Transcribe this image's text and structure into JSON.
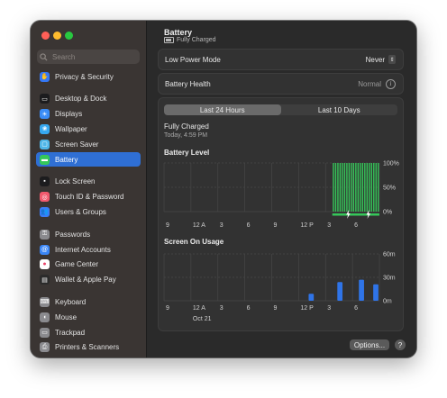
{
  "window": {
    "search_placeholder": "Search",
    "sidebar": {
      "groups": [
        [
          {
            "label": "Privacy & Security",
            "icon": "hand-icon",
            "color": "#3478f6",
            "glyph": "✋"
          }
        ],
        [
          {
            "label": "Desktop & Dock",
            "icon": "desktop-icon",
            "color": "#1c1c1e",
            "glyph": "▭"
          },
          {
            "label": "Displays",
            "icon": "displays-icon",
            "color": "#3a8cf7",
            "glyph": "☀"
          },
          {
            "label": "Wallpaper",
            "icon": "wallpaper-icon",
            "color": "#36a8f0",
            "glyph": "❀"
          },
          {
            "label": "Screen Saver",
            "icon": "screen-saver-icon",
            "color": "#4fb6e8",
            "glyph": "▢"
          },
          {
            "label": "Battery",
            "icon": "battery-icon",
            "color": "#35c759",
            "glyph": "▬"
          }
        ],
        [
          {
            "label": "Lock Screen",
            "icon": "lock-screen-icon",
            "color": "#1c1c1e",
            "glyph": "▪"
          },
          {
            "label": "Touch ID & Password",
            "icon": "fingerprint-icon",
            "color": "#f25a6e",
            "glyph": "◎"
          },
          {
            "label": "Users & Groups",
            "icon": "users-icon",
            "color": "#3a7cf6",
            "glyph": "👥"
          }
        ],
        [
          {
            "label": "Passwords",
            "icon": "key-icon",
            "color": "#8a8a8e",
            "glyph": "⚿"
          },
          {
            "label": "Internet Accounts",
            "icon": "at-icon",
            "color": "#3a86f6",
            "glyph": "@"
          },
          {
            "label": "Game Center",
            "icon": "game-center-icon",
            "color": "#ffffff",
            "glyph": "●"
          },
          {
            "label": "Wallet & Apple Pay",
            "icon": "wallet-icon",
            "color": "#2b2b2b",
            "glyph": "▤"
          }
        ],
        [
          {
            "label": "Keyboard",
            "icon": "keyboard-icon",
            "color": "#8a8a8e",
            "glyph": "⌨"
          },
          {
            "label": "Mouse",
            "icon": "mouse-icon",
            "color": "#8a8a8e",
            "glyph": "◖"
          },
          {
            "label": "Trackpad",
            "icon": "trackpad-icon",
            "color": "#8a8a8e",
            "glyph": "▭"
          },
          {
            "label": "Printers & Scanners",
            "icon": "printer-icon",
            "color": "#8a8a8e",
            "glyph": "⎙"
          }
        ]
      ],
      "selected": "Battery"
    }
  },
  "header": {
    "title": "Battery",
    "status": "Fully Charged"
  },
  "settings": {
    "low_power_label": "Low Power Mode",
    "low_power_value": "Never",
    "health_label": "Battery Health",
    "health_value": "Normal"
  },
  "history": {
    "tabs": [
      "Last 24 Hours",
      "Last 10 Days"
    ],
    "active_tab": 0,
    "charge_state": "Fully Charged",
    "charge_time": "Today, 4:59 PM",
    "battery_level_label": "Battery Level",
    "screen_on_label": "Screen On Usage"
  },
  "chart_data": [
    {
      "type": "bar",
      "title": "Battery Level",
      "x_ticks": [
        "9",
        "12 A",
        "3",
        "6",
        "9",
        "12 P",
        "3",
        "6"
      ],
      "y_ticks": [
        "100%",
        "50%",
        "0%"
      ],
      "ylim": [
        0,
        100
      ],
      "bar_color": "#35c759",
      "values": [
        0,
        0,
        0,
        0,
        0,
        0,
        0,
        0,
        0,
        0,
        0,
        0,
        0,
        0,
        0,
        0,
        0,
        0,
        0,
        0,
        0,
        0,
        0,
        0,
        0,
        0,
        0,
        0,
        0,
        0,
        0,
        0,
        0,
        0,
        0,
        0,
        0,
        0,
        0,
        0,
        0,
        0,
        0,
        0,
        0,
        0,
        0,
        0,
        0,
        0,
        0,
        0,
        0,
        0,
        0,
        0,
        0,
        0,
        0,
        0,
        0,
        0,
        0,
        0,
        0,
        0,
        0,
        0,
        0,
        0,
        0,
        0,
        0,
        0,
        0,
        100,
        100,
        100,
        100,
        100,
        100,
        100,
        100,
        100,
        100,
        100,
        100,
        100,
        100,
        100,
        100,
        100,
        100,
        100,
        100,
        100
      ],
      "charging_markers": [
        82,
        91
      ]
    },
    {
      "type": "bar",
      "title": "Screen On Usage",
      "x_ticks": [
        "9",
        "12 A",
        "3",
        "6",
        "9",
        "12 P",
        "3",
        "6"
      ],
      "x_sublabel": "Oct 21",
      "y_ticks": [
        "60m",
        "30m",
        "0m"
      ],
      "ylim": [
        0,
        60
      ],
      "bar_color": "#2f74e8",
      "values": [
        0,
        0,
        0,
        0,
        0,
        0,
        0,
        0,
        0,
        0,
        0,
        0,
        0,
        0,
        0,
        0,
        0,
        0,
        0,
        0,
        9,
        0,
        0,
        0,
        24,
        0,
        0,
        27,
        0,
        21
      ]
    }
  ]
}
